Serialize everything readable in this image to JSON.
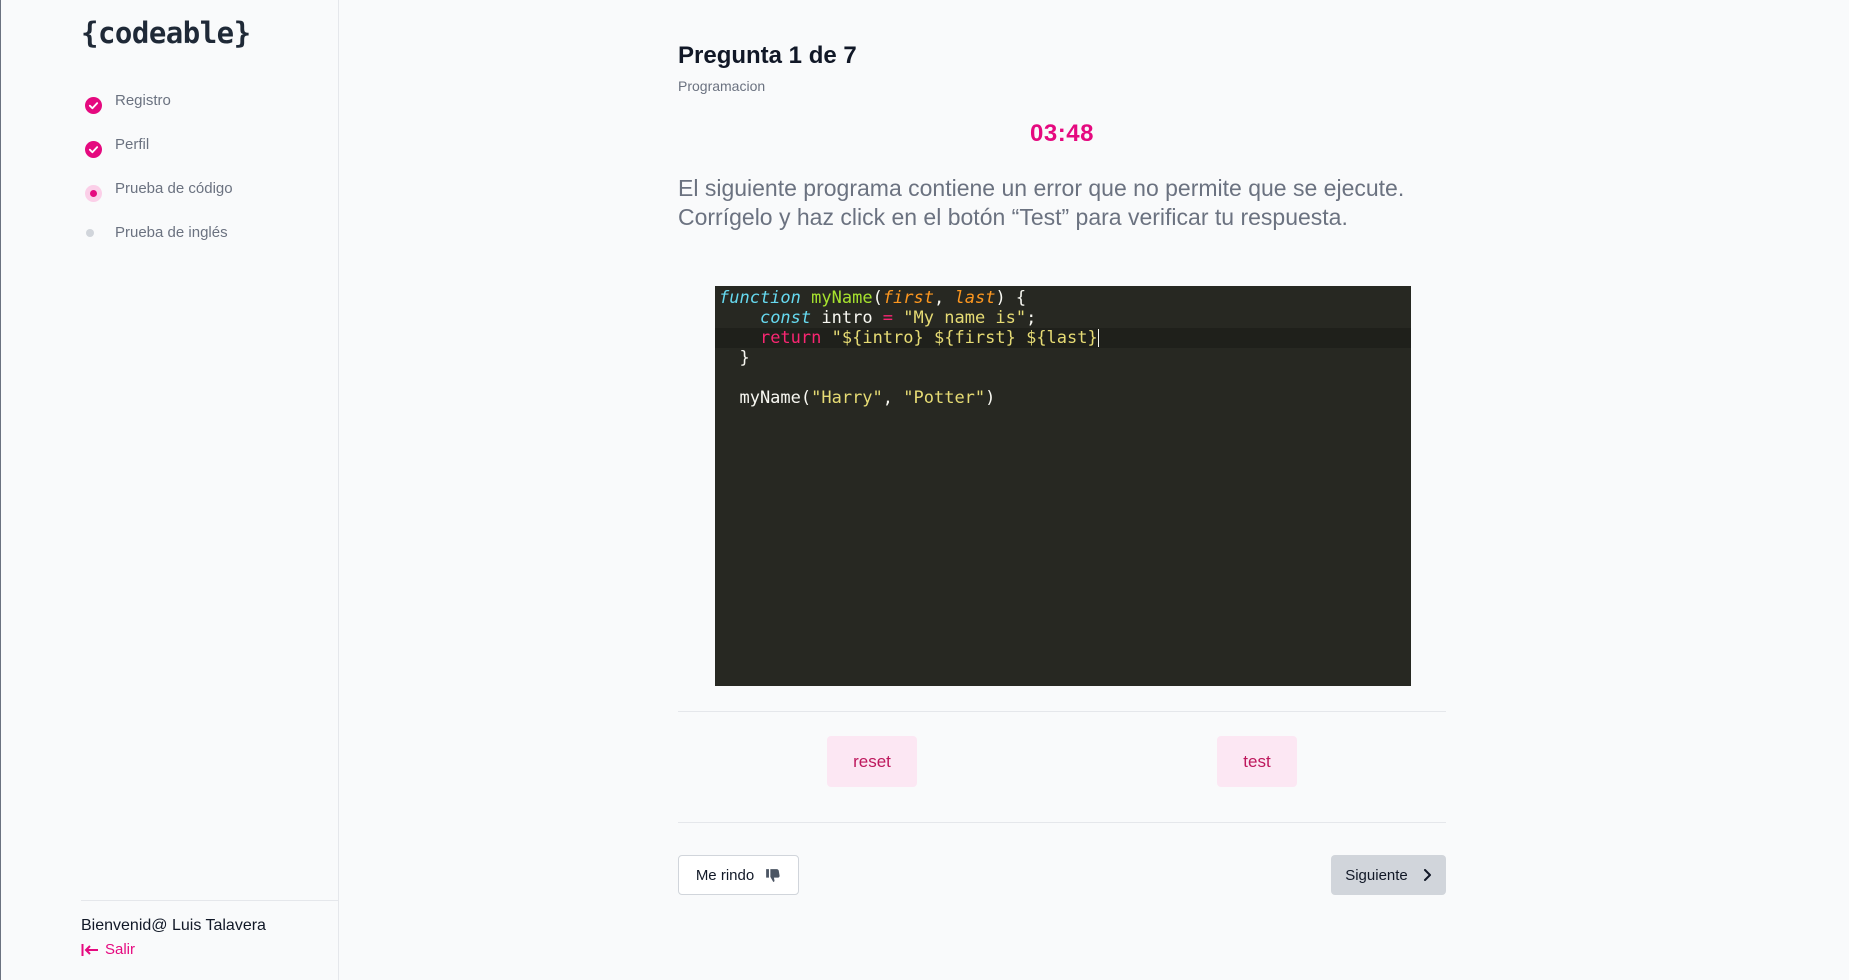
{
  "brand": {
    "logo": "{codeable}"
  },
  "sidebar": {
    "steps": [
      {
        "label": "Registro",
        "status": "done"
      },
      {
        "label": "Perfil",
        "status": "done"
      },
      {
        "label": "Prueba de código",
        "status": "current"
      },
      {
        "label": "Prueba de inglés",
        "status": "pending"
      }
    ],
    "footer": {
      "welcome": "Bienvenid@ Luis Talavera",
      "logout_label": "Salir"
    }
  },
  "question": {
    "title": "Pregunta 1 de 7",
    "category": "Programacion",
    "timer": "03:48",
    "prompt": "El siguiente programa contiene un error que no permite que se ejecute. Corrígelo y haz click en el botón “Test” para verificar tu respuesta."
  },
  "editor": {
    "lines": [
      "function myName(first, last) {",
      "    const intro = \"My name is\";",
      "    return \"${intro} ${first} ${last}",
      "  }",
      "",
      "  myName(\"Harry\", \"Potter\")"
    ]
  },
  "actions": {
    "reset_label": "reset",
    "test_label": "test",
    "give_up_label": "Me rindo",
    "next_label": "Siguiente"
  },
  "colors": {
    "accent": "#e5097f",
    "accent_soft": "#fce7f3",
    "editor_bg": "#272822"
  },
  "icons": {
    "done": "check-circle-icon",
    "logout": "logout-arrow-icon",
    "give_up": "thumbs-down-icon",
    "next": "chevron-right-icon"
  }
}
